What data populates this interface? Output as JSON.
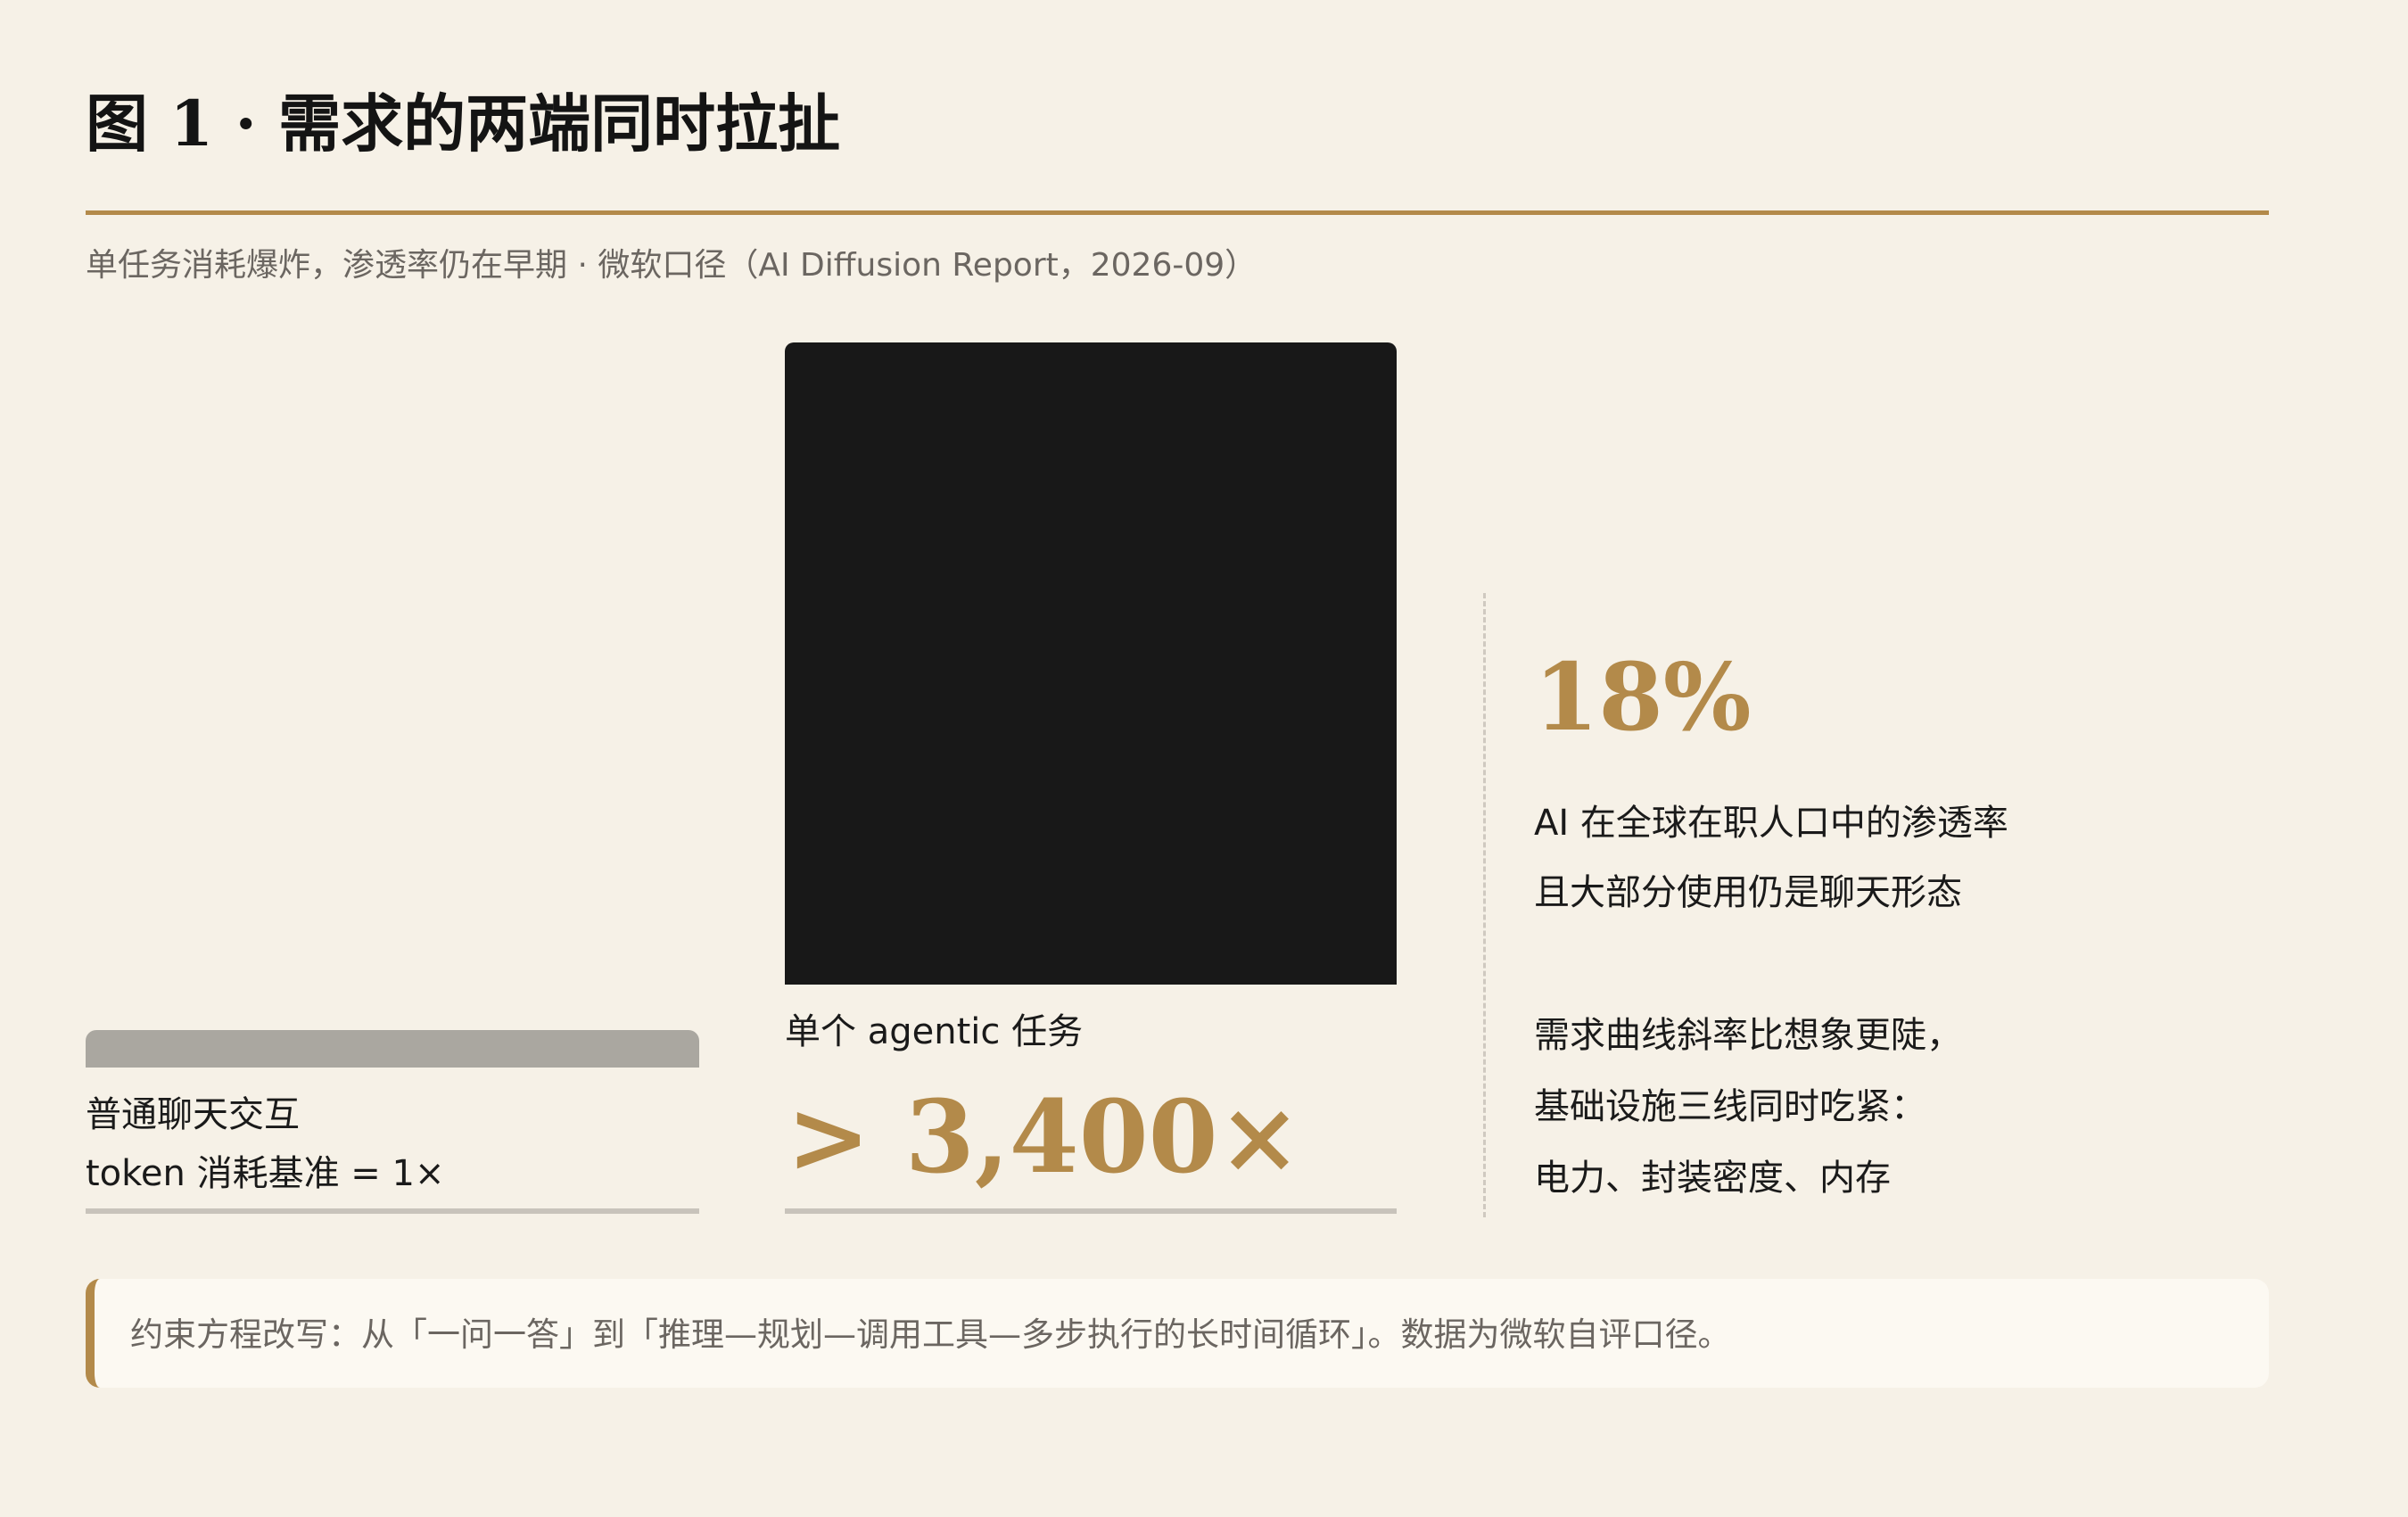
{
  "title": "图 1 · 需求的两端同时拉扯",
  "subtitle": "单任务消耗爆炸，渗透率仍在早期 · 微软口径（AI Diffusion Report，2026-09）",
  "chart_data": {
    "type": "bar",
    "categories": [
      "普通聊天交互",
      "单个 agentic 任务"
    ],
    "values": [
      1,
      3400
    ],
    "bar_labels": [
      [
        "普通聊天交互",
        "token 消耗基准 = 1×"
      ],
      [
        "单个 agentic 任务"
      ]
    ],
    "big_value_label": "> 3,400×",
    "colors": {
      "baseline": "#aaa7a0",
      "agentic": "#181818",
      "accent": "#b38a4a"
    }
  },
  "side_panel": {
    "stat": "18%",
    "stat_desc": [
      "AI 在全球在职人口中的渗透率",
      "且大部分使用仍是聊天形态"
    ],
    "implication": [
      "需求曲线斜率比想象更陡，",
      "基础设施三线同时吃紧：",
      "电力、封装密度、内存"
    ]
  },
  "note": "约束方程改写：从「一问一答」到「推理—规划—调用工具—多步执行的长时间循环」。数据为微软自评口径。"
}
